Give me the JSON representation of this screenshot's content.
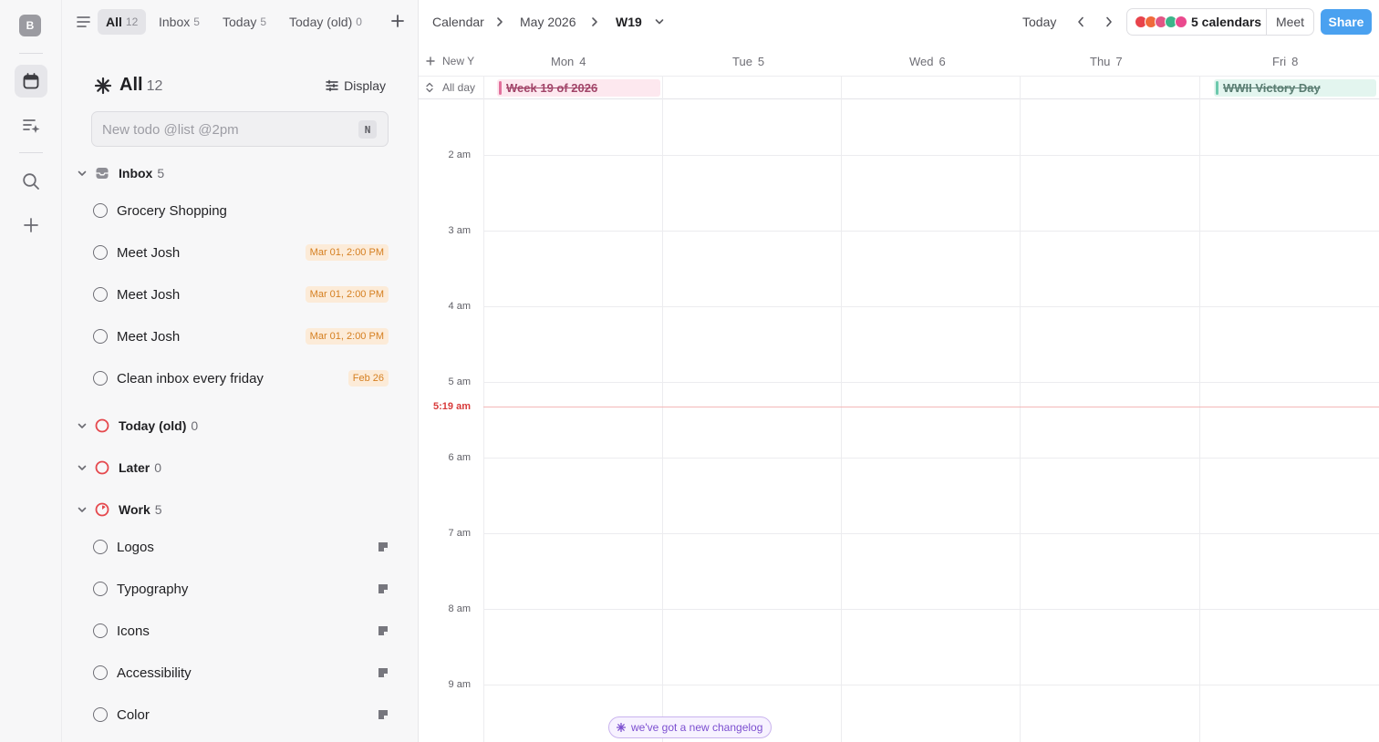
{
  "rail": {
    "avatar_letter": "B"
  },
  "panel": {
    "tabs": [
      {
        "label": "All",
        "count": "12"
      },
      {
        "label": "Inbox",
        "count": "5"
      },
      {
        "label": "Today",
        "count": "5"
      },
      {
        "label": "Today (old)",
        "count": "0"
      }
    ],
    "header": {
      "title": "All",
      "count": "12",
      "display_label": "Display"
    },
    "new_todo": {
      "placeholder": "New todo @list @2pm",
      "value": "",
      "shortcut": "N"
    },
    "groups": {
      "inbox": {
        "label": "Inbox",
        "count": "5"
      },
      "today_old": {
        "label": "Today (old)",
        "count": "0"
      },
      "later": {
        "label": "Later",
        "count": "0"
      },
      "work": {
        "label": "Work",
        "count": "5"
      }
    },
    "inbox_items": [
      {
        "label": "Grocery Shopping",
        "badge": ""
      },
      {
        "label": "Meet Josh",
        "badge": "Mar 01, 2:00 PM"
      },
      {
        "label": "Meet Josh",
        "badge": "Mar 01, 2:00 PM"
      },
      {
        "label": "Meet Josh",
        "badge": "Mar 01, 2:00 PM"
      },
      {
        "label": "Clean inbox every friday",
        "badge": "Feb 26"
      }
    ],
    "work_items": [
      {
        "label": "Logos"
      },
      {
        "label": "Typography"
      },
      {
        "label": "Icons"
      },
      {
        "label": "Accessibility"
      },
      {
        "label": "Color"
      }
    ]
  },
  "calendar": {
    "breadcrumb": [
      "Calendar",
      "May 2026",
      "W19"
    ],
    "today_label": "Today",
    "calendars_label": "5 calendars",
    "calendar_colors": [
      "#e8434b",
      "#f06a3b",
      "#e25585",
      "#3cb58a",
      "#ea4a8e"
    ],
    "meet_label": "Meet",
    "share_label": "Share",
    "new_event_label": "New Y",
    "days": [
      {
        "name": "Mon",
        "num": "4"
      },
      {
        "name": "Tue",
        "num": "5"
      },
      {
        "name": "Wed",
        "num": "6"
      },
      {
        "name": "Thu",
        "num": "7"
      },
      {
        "name": "Fri",
        "num": "8"
      }
    ],
    "all_day_label": "All day",
    "all_day_events": [
      {
        "title": "Week 19 of 2026",
        "day": "Mon"
      },
      {
        "title": "WWII Victory Day",
        "day": "Fri"
      }
    ],
    "hours": [
      "2 am",
      "3 am",
      "4 am",
      "5 am",
      "6 am",
      "7 am",
      "8 am",
      "9 am"
    ],
    "now_label": "5:19 am",
    "changelog_label": "we've got a new changelog"
  }
}
